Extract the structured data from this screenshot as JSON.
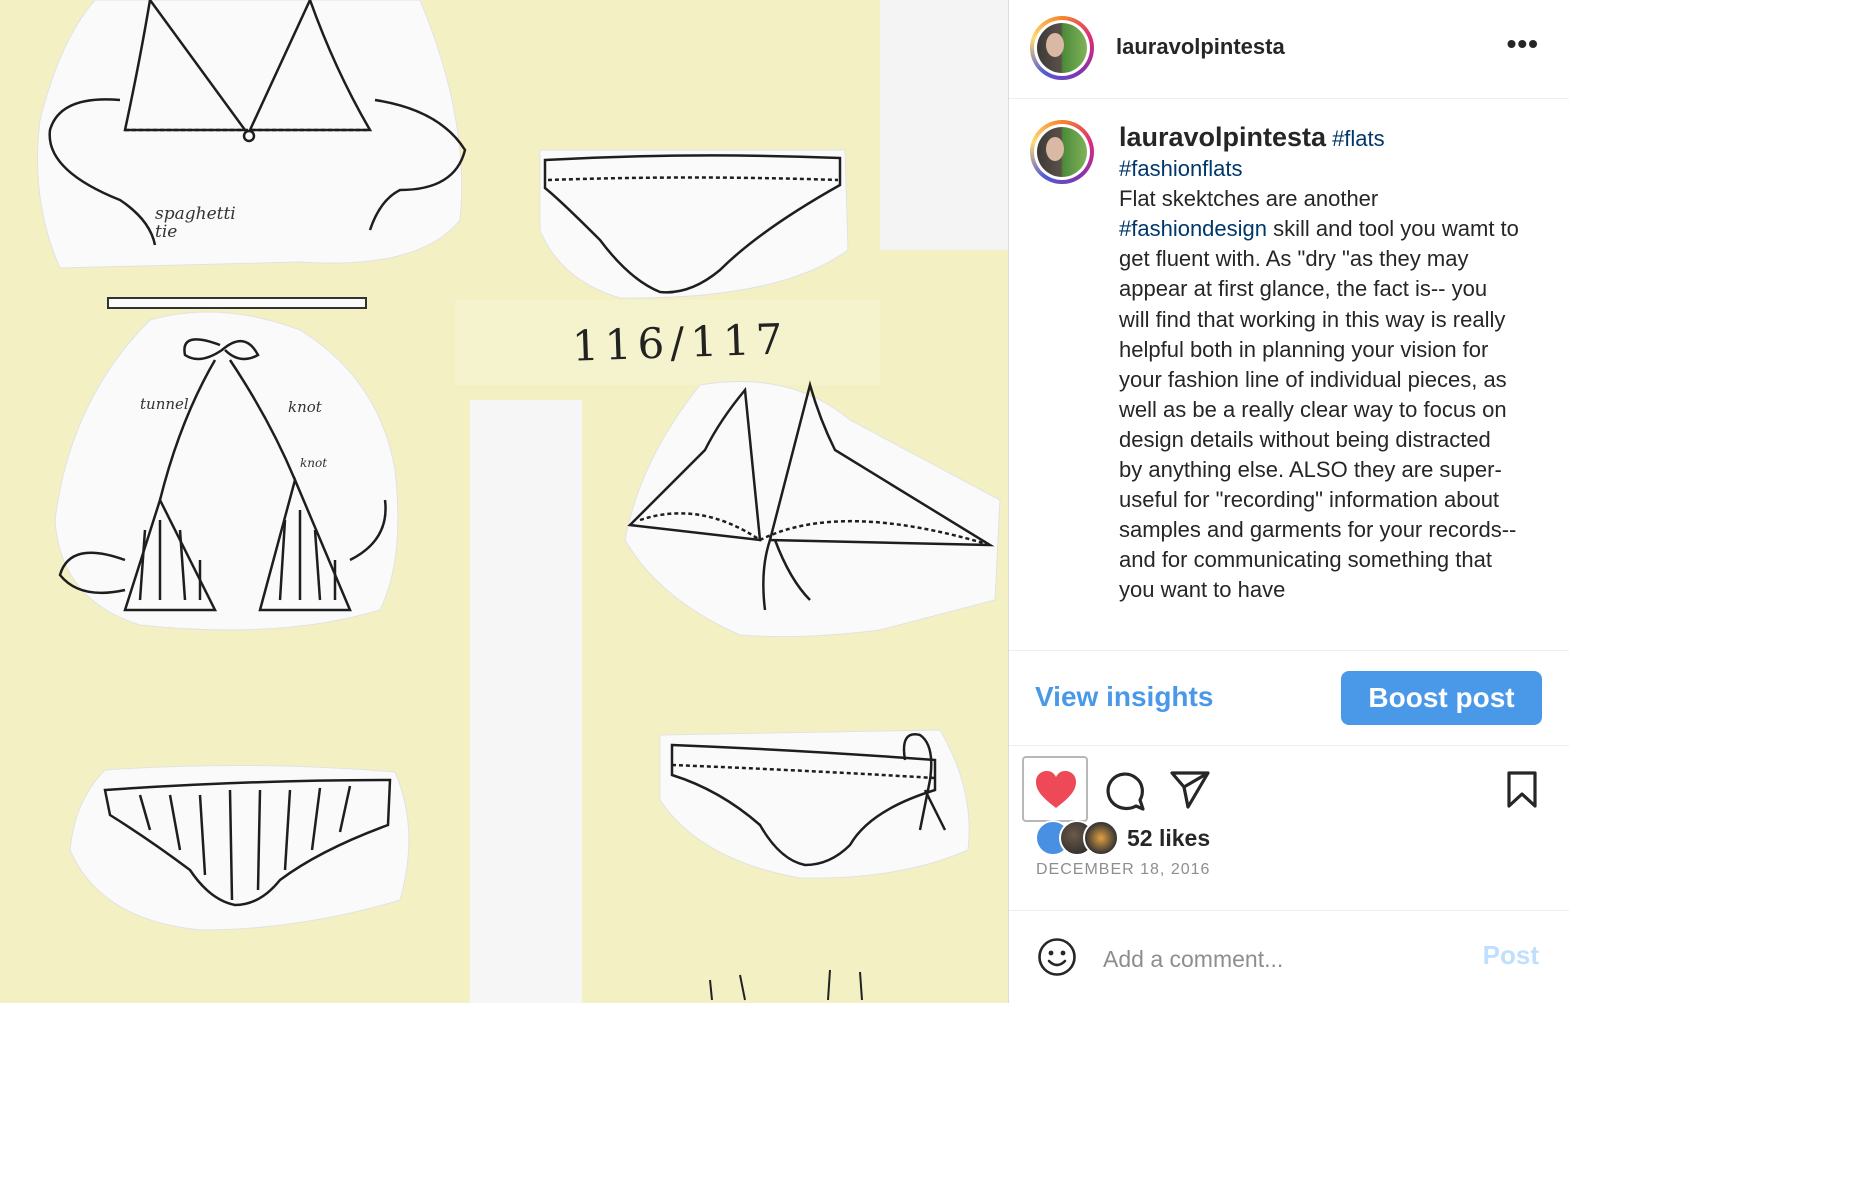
{
  "post": {
    "username": "lauravolpintesta",
    "more_icon": "more-horizontal-icon",
    "caption": {
      "username": "lauravolpintesta",
      "tag_flats": "#flats",
      "tag_fashionflats": "#fashionflats",
      "text_1": "Flat skektches are another ",
      "tag_fashiondesign": "#fashiondesign",
      "text_2": " skill and tool you wamt to get fluent with. As \"dry \"as they may appear at first glance, the fact is-- you will find that working in this way is really helpful both in planning your vision for your fashion line of individual pieces, as well as be a really clear way to focus on design details without being distracted by anything else. ALSO they are super- useful for \"recording\" information about samples and garments for your records-- and for communicating something that you want to have"
    },
    "view_insights_label": "View insights",
    "boost_label": "Boost post",
    "likes": "52 likes",
    "date": "DECEMBER 18, 2016",
    "liked": true,
    "comment_placeholder": "Add a comment...",
    "post_label": "Post"
  },
  "photo": {
    "number_label": "116/117",
    "notes": {
      "spaghetti": "spaghetti tie",
      "tunnel": "tunnel",
      "knot1": "knot",
      "knot2": "knot"
    }
  },
  "icons": {
    "like": "heart-icon",
    "comment": "comment-icon",
    "share": "paper-plane-icon",
    "save": "bookmark-icon",
    "emoji": "smiley-icon"
  },
  "colors": {
    "accent": "#4a98e8",
    "like": "#ed4956",
    "photo_bg": "#f3f1c3",
    "link": "#00376b"
  }
}
